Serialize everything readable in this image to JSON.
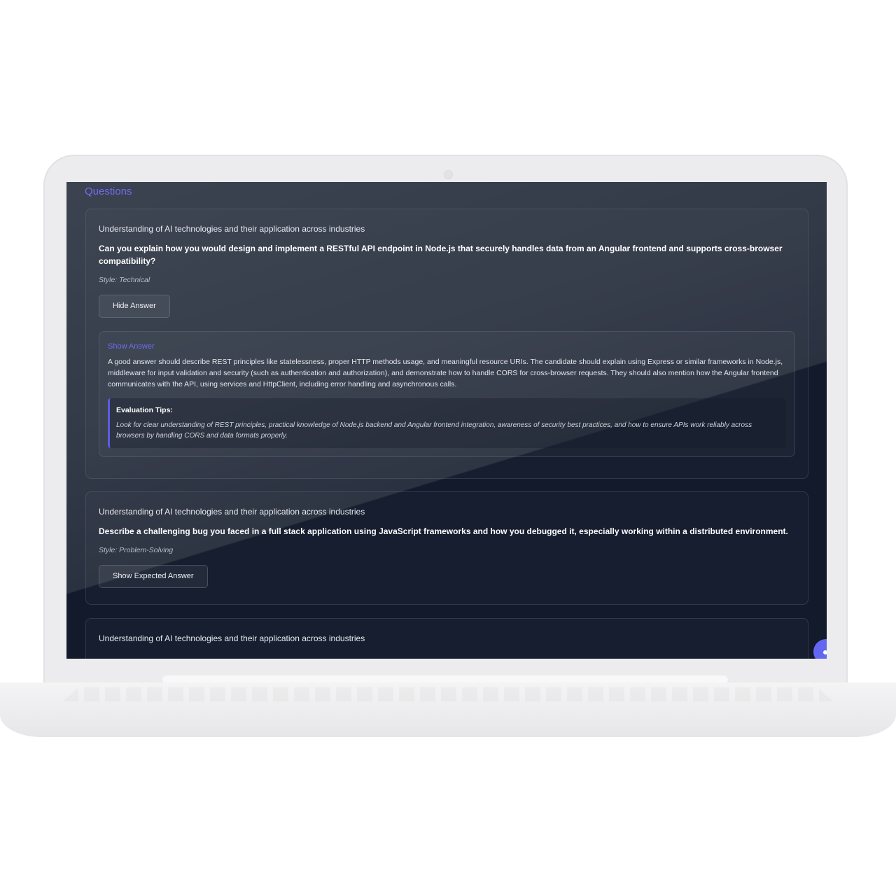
{
  "header": {
    "title": "Questions"
  },
  "questions": [
    {
      "topic": "Understanding of AI technologies and their application across industries",
      "question": "Can you explain how you would design and implement a RESTful API endpoint in Node.js that securely handles data from an Angular frontend and supports cross-browser compatibility?",
      "style": "Style: Technical",
      "button_label": "Hide Answer",
      "answer": {
        "heading": "Show Answer",
        "text": "A good answer should describe REST principles like statelessness, proper HTTP methods usage, and meaningful resource URIs. The candidate should explain using Express or similar frameworks in Node.js, middleware for input validation and security (such as authentication and authorization), and demonstrate how to handle CORS for cross-browser requests. They should also mention how the Angular frontend communicates with the API, using services and HttpClient, including error handling and asynchronous calls.",
        "tips_title": "Evaluation Tips:",
        "tips_text": "Look for clear understanding of REST principles, practical knowledge of Node.js backend and Angular frontend integration, awareness of security best practices, and how to ensure APIs work reliably across browsers by handling CORS and data formats properly."
      }
    },
    {
      "topic": "Understanding of AI technologies and their application across industries",
      "question": "Describe a challenging bug you faced in a full stack application using JavaScript frameworks and how you debugged it, especially working within a distributed environment.",
      "style": "Style: Problem-Solving",
      "button_label": "Show Expected Answer"
    },
    {
      "topic": "Understanding of AI technologies and their application across industries"
    }
  ],
  "colors": {
    "accent": "#6d6cf0",
    "background": "#121a2b",
    "fab": "#6366f1"
  }
}
